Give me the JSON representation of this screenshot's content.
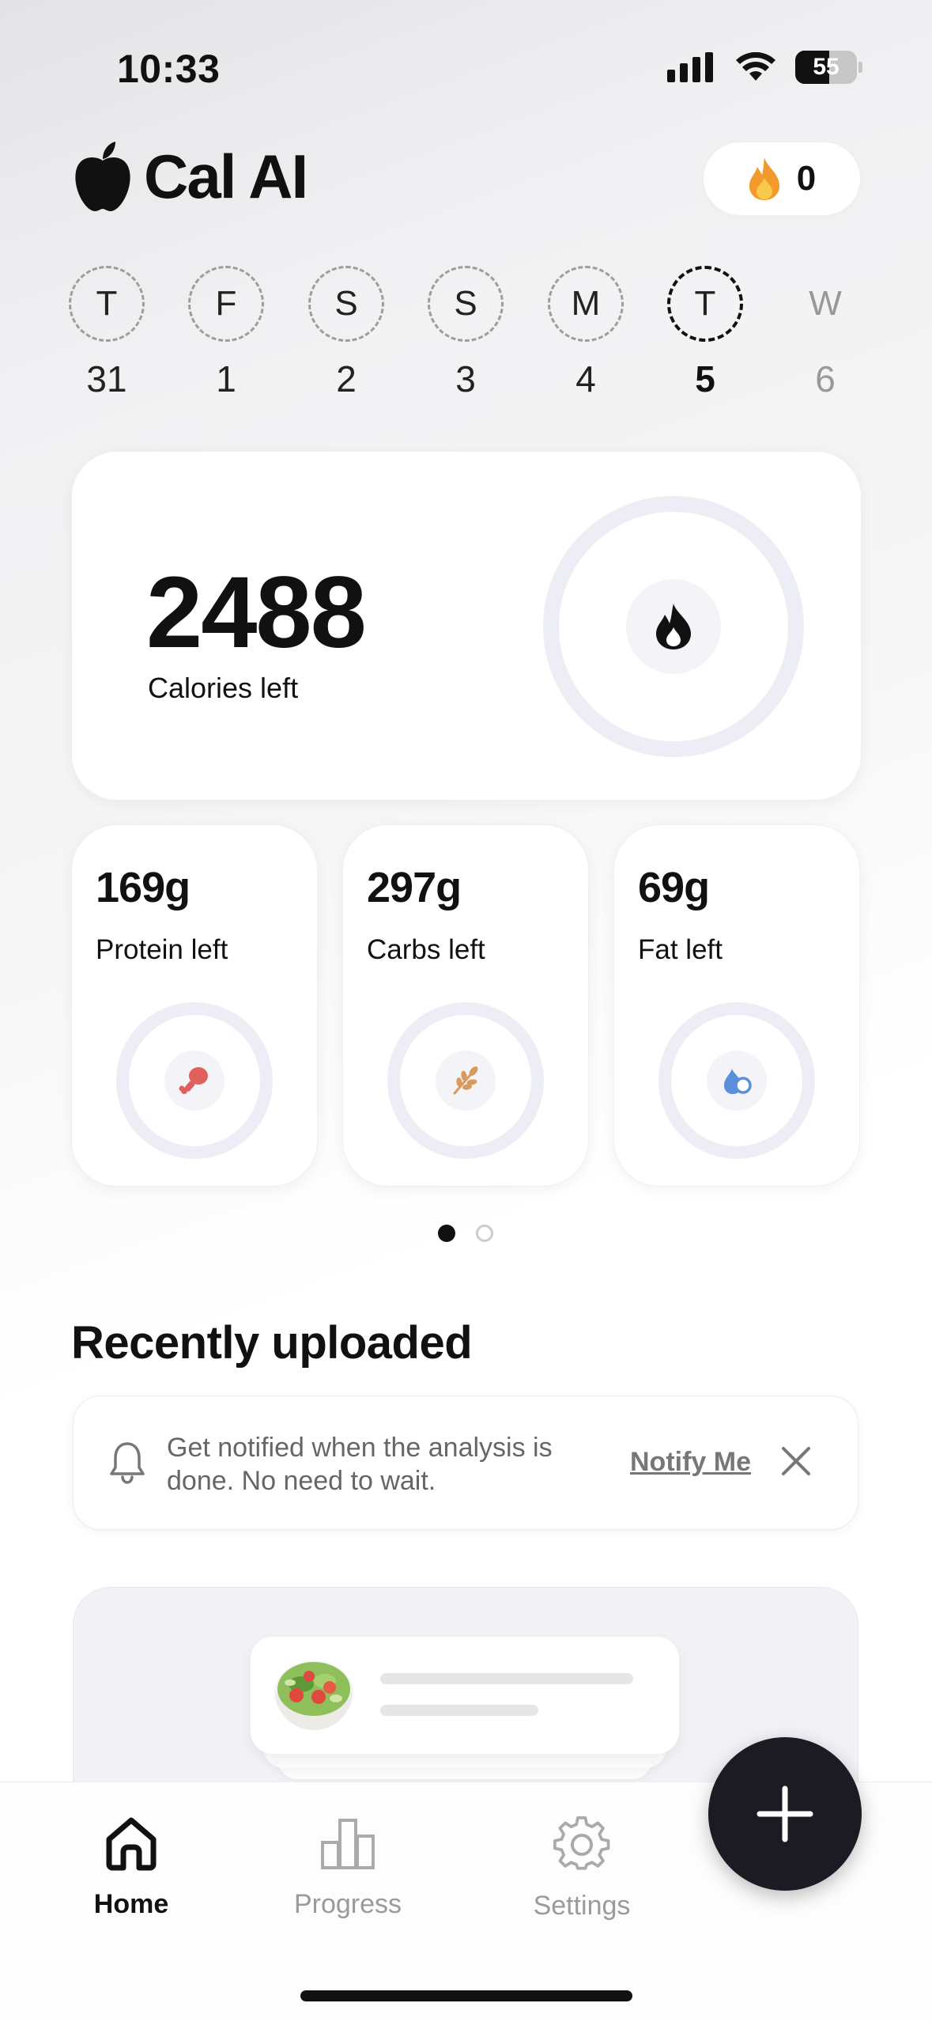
{
  "status_bar": {
    "time": "10:33",
    "battery": "55"
  },
  "header": {
    "app_name": "Cal AI",
    "streak_count": "0"
  },
  "week": [
    {
      "letter": "T",
      "date": "31",
      "state": "past"
    },
    {
      "letter": "F",
      "date": "1",
      "state": "past"
    },
    {
      "letter": "S",
      "date": "2",
      "state": "past"
    },
    {
      "letter": "S",
      "date": "3",
      "state": "past"
    },
    {
      "letter": "M",
      "date": "4",
      "state": "past"
    },
    {
      "letter": "T",
      "date": "5",
      "state": "active"
    },
    {
      "letter": "W",
      "date": "6",
      "state": "future"
    }
  ],
  "calories": {
    "value": "2488",
    "label": "Calories left",
    "progress": 0
  },
  "macros": [
    {
      "value": "169g",
      "label": "Protein left",
      "icon": "drumstick-icon",
      "color": "#e0605e"
    },
    {
      "value": "297g",
      "label": "Carbs left",
      "icon": "wheat-icon",
      "color": "#d89a5e"
    },
    {
      "value": "69g",
      "label": "Fat left",
      "icon": "fat-drop-icon",
      "color": "#5b8fdc"
    }
  ],
  "pager": {
    "current": 1,
    "total": 2
  },
  "recent": {
    "title": "Recently uploaded",
    "notify_message": "Get notified when the analysis is done. No need to wait.",
    "notify_link": "Notify Me"
  },
  "tabs": [
    {
      "label": "Home",
      "icon": "home-icon",
      "active": true
    },
    {
      "label": "Progress",
      "icon": "bar-chart-icon",
      "active": false
    },
    {
      "label": "Settings",
      "icon": "gear-icon",
      "active": false
    }
  ],
  "colors": {
    "fab": "#1c1a22",
    "ring": "#ededf5",
    "accent_text": "#111111"
  }
}
